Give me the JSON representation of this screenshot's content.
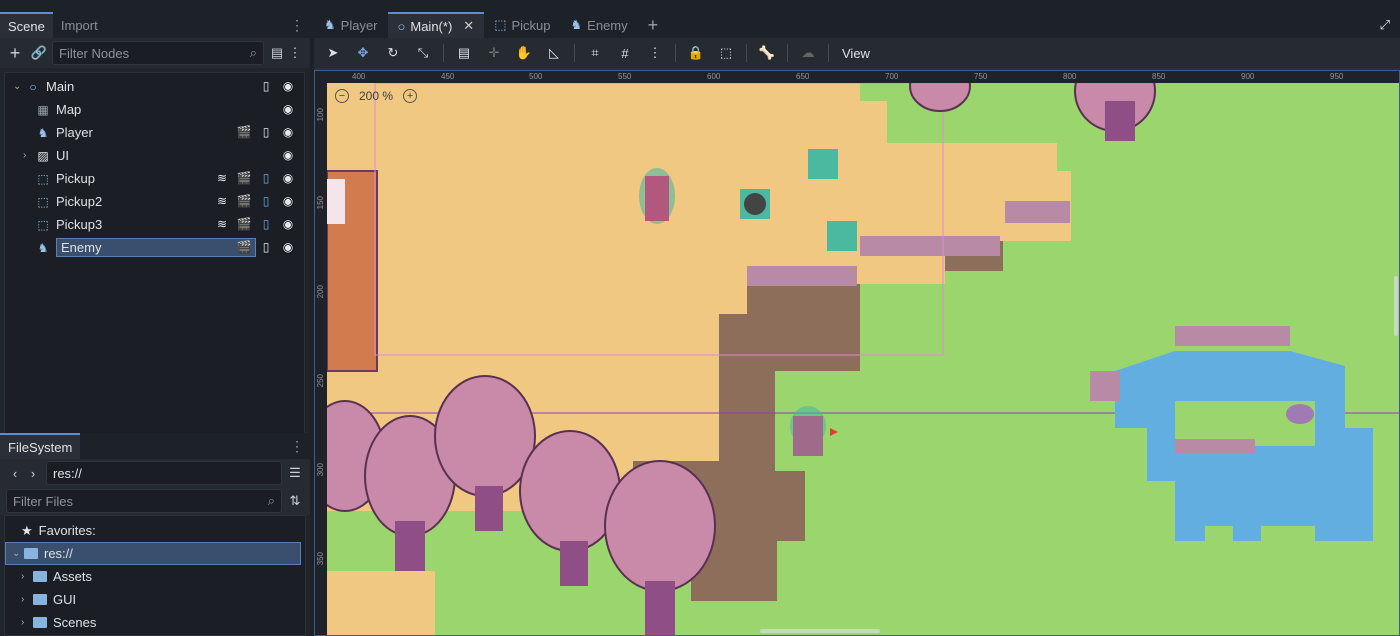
{
  "left_dock": {
    "tabs": [
      "Scene",
      "Import"
    ],
    "filter_nodes_placeholder": "Filter Nodes",
    "tree": [
      {
        "label": "Main",
        "icon": "node2d-circle-icon"
      },
      {
        "label": "Map",
        "icon": "tilemap-icon"
      },
      {
        "label": "Player",
        "icon": "character-icon"
      },
      {
        "label": "UI",
        "icon": "canvas-layer-icon"
      },
      {
        "label": "Pickup",
        "icon": "area2d-icon"
      },
      {
        "label": "Pickup2",
        "icon": "area2d-icon"
      },
      {
        "label": "Pickup3",
        "icon": "area2d-icon"
      },
      {
        "label": "Enemy",
        "icon": "character-icon"
      }
    ]
  },
  "filesystem": {
    "tab": "FileSystem",
    "path": "res://",
    "filter_placeholder": "Filter Files",
    "favorites_label": "Favorites:",
    "root": "res://",
    "folders": [
      "Assets",
      "GUI",
      "Scenes"
    ]
  },
  "editor": {
    "tabs": [
      "Player",
      "Main(*)",
      "Pickup",
      "Enemy"
    ],
    "active_tab": "Main(*)",
    "view_menu": "View",
    "zoom_label": "200 %",
    "ruler_x": [
      "400",
      "450",
      "500",
      "550",
      "600",
      "650",
      "700",
      "750",
      "800",
      "850",
      "900",
      "950"
    ],
    "ruler_y": [
      "100",
      "150",
      "200",
      "250",
      "300",
      "350"
    ]
  },
  "colors": {
    "grass": "#9ad66d",
    "sand": "#f0c882",
    "dirt": "#8d6e5a",
    "water": "#62aee0",
    "tree": "#c07aa8",
    "accent": "#5c8dd6"
  }
}
